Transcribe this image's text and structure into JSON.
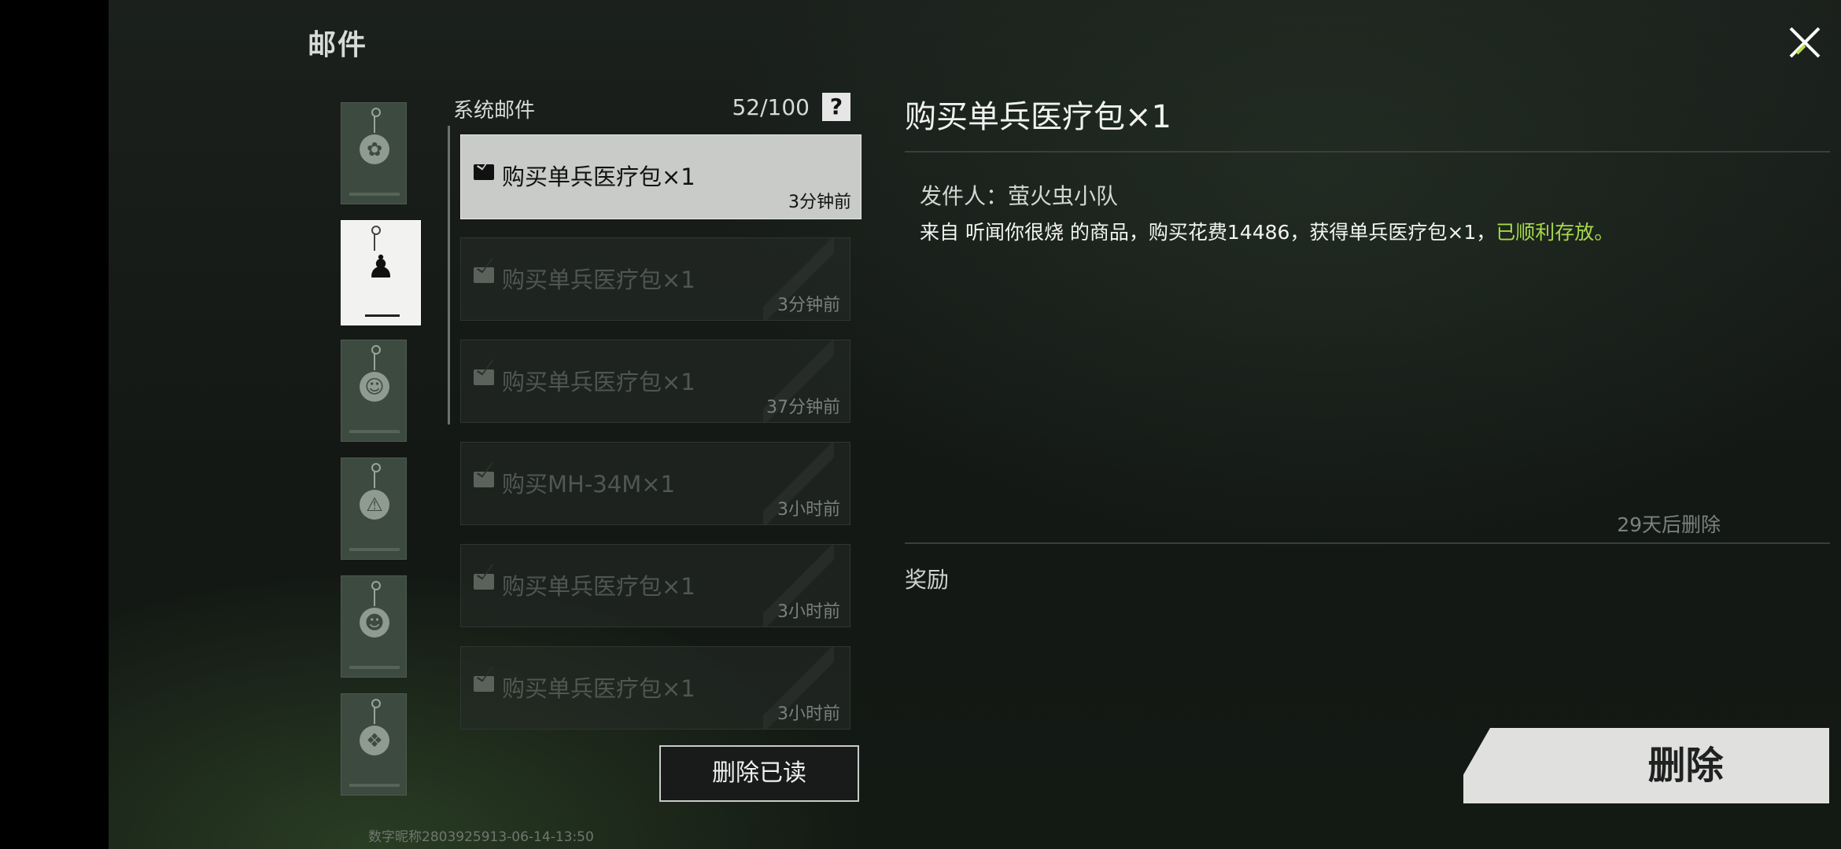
{
  "window": {
    "title": "邮件"
  },
  "categories": [
    {
      "name": "flower",
      "icon": "✿"
    },
    {
      "name": "user",
      "icon": "♟"
    },
    {
      "name": "chat",
      "icon": "☺"
    },
    {
      "name": "warning",
      "icon": "⚠"
    },
    {
      "name": "avatar",
      "icon": "☻"
    },
    {
      "name": "bag",
      "icon": "❖"
    }
  ],
  "list": {
    "title": "系统邮件",
    "count": "52/100",
    "help_label": "?",
    "items": [
      {
        "subject": "购买单兵医疗包×1",
        "time": "3分钟前"
      },
      {
        "subject": "购买单兵医疗包×1",
        "time": "3分钟前"
      },
      {
        "subject": "购买单兵医疗包×1",
        "time": "37分钟前"
      },
      {
        "subject": "购买MH-34M×1",
        "time": "3小时前"
      },
      {
        "subject": "购买单兵医疗包×1",
        "time": "3小时前"
      },
      {
        "subject": "购买单兵医疗包×1",
        "time": "3小时前"
      }
    ],
    "delete_read_label": "删除已读"
  },
  "footer": {
    "text": "数字昵称2803925913-06-14-13:50"
  },
  "detail": {
    "title": "购买单兵医疗包×1",
    "sender": "发件人：萤火虫小队",
    "body_main": "来自 听闻你很烧 的商品，购买花费14486，获得单兵医疗包×1，",
    "body_highlight": "已顺利存放。",
    "expire": "29天后删除",
    "reward_label": "奖励",
    "delete_label": "删除"
  },
  "colors": {
    "highlight": "#a6d94a",
    "selected_bg": "#c8cbc8"
  }
}
